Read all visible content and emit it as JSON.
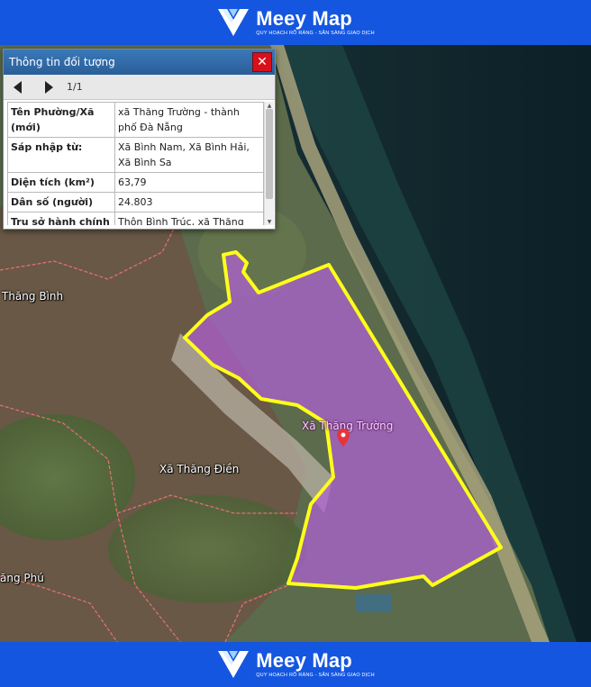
{
  "brand": {
    "name": "Meey Map",
    "tagline": "QUY HOẠCH RÕ RÀNG - SẴN SÀNG GIAO DỊCH"
  },
  "info_panel": {
    "title": "Thông tin đối tượng",
    "close_label": "✕",
    "pager": "1/1",
    "rows": [
      {
        "key": "Tên Phường/Xã (mới)",
        "value": "xã Thăng Trường - thành phố Đà Nẵng"
      },
      {
        "key": "Sáp nhập từ:",
        "value": "Xã Bình Nam, Xã Bình Hải, Xã Bình Sa"
      },
      {
        "key": "Diện tích (km²)",
        "value": "63,79"
      },
      {
        "key": "Dân số (người)",
        "value": "24.803"
      },
      {
        "key": "Trụ sở hành chính (mới)",
        "value": "Thôn Bình Trúc, xã Thăng Trường"
      }
    ]
  },
  "map": {
    "labels": {
      "thang_binh": "Thăng Bình",
      "thang_dien": "Xã Thăng Điền",
      "thang_phu": "ăng Phú",
      "thang_truong": "Xã Thăng Trường"
    },
    "colors": {
      "boundary": "#ffff1a",
      "fill": "#b05fd6",
      "pin": "#e8333a",
      "admin_line": "#e07070"
    }
  }
}
